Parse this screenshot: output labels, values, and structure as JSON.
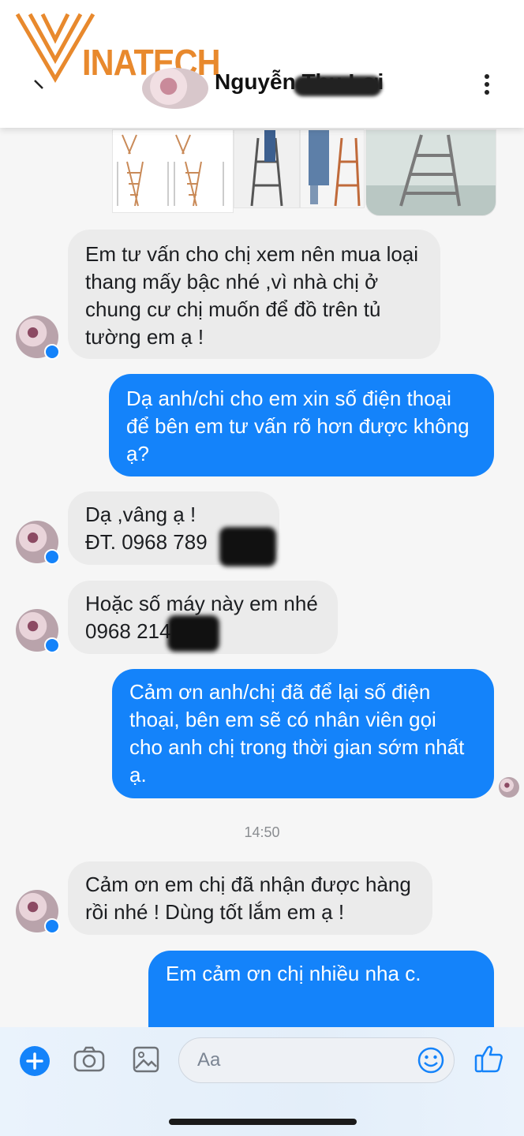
{
  "brand": {
    "logo_text": "INATECH",
    "logo_letter": "V"
  },
  "header": {
    "contact_name": "Nguyễn Thu Lợi"
  },
  "messages": {
    "m1": {
      "lines": [
        "Em tư vấn cho chị xem nên mua loại",
        "thang mấy bậc nhé ,vì nhà chị ở",
        "chung cư  chị muốn để đồ trên tủ",
        "tường em ạ !"
      ]
    },
    "m2": {
      "lines": [
        "Dạ anh/chi cho em xin số điện thoại",
        "để bên em tư vấn rõ hơn được không",
        "ạ?"
      ]
    },
    "m3": {
      "lines": [
        "Dạ ,vâng ạ !",
        "ĐT. 0968  789"
      ]
    },
    "m4": {
      "lines": [
        "Hoặc số máy này em nhé",
        "0968 214789"
      ]
    },
    "m5": {
      "lines": [
        "Cảm ơn anh/chị đã để lại số điện",
        "thoại, bên em sẽ có nhân viên gọi",
        "cho anh chị trong thời gian sớm nhất",
        "ạ."
      ]
    },
    "m6": {
      "lines": [
        "Cảm ơn em chị đã nhận được hàng",
        "rồi nhé ! Dùng tốt lắm em ạ !"
      ]
    },
    "m7": {
      "lines": [
        "Em cảm ơn chị nhiều nha c."
      ]
    }
  },
  "timestamp": "14:50",
  "composer": {
    "placeholder": "Aa"
  },
  "colors": {
    "outgoing": "#1483fa",
    "incoming": "#ebebeb",
    "brand_orange": "#e8892d"
  }
}
